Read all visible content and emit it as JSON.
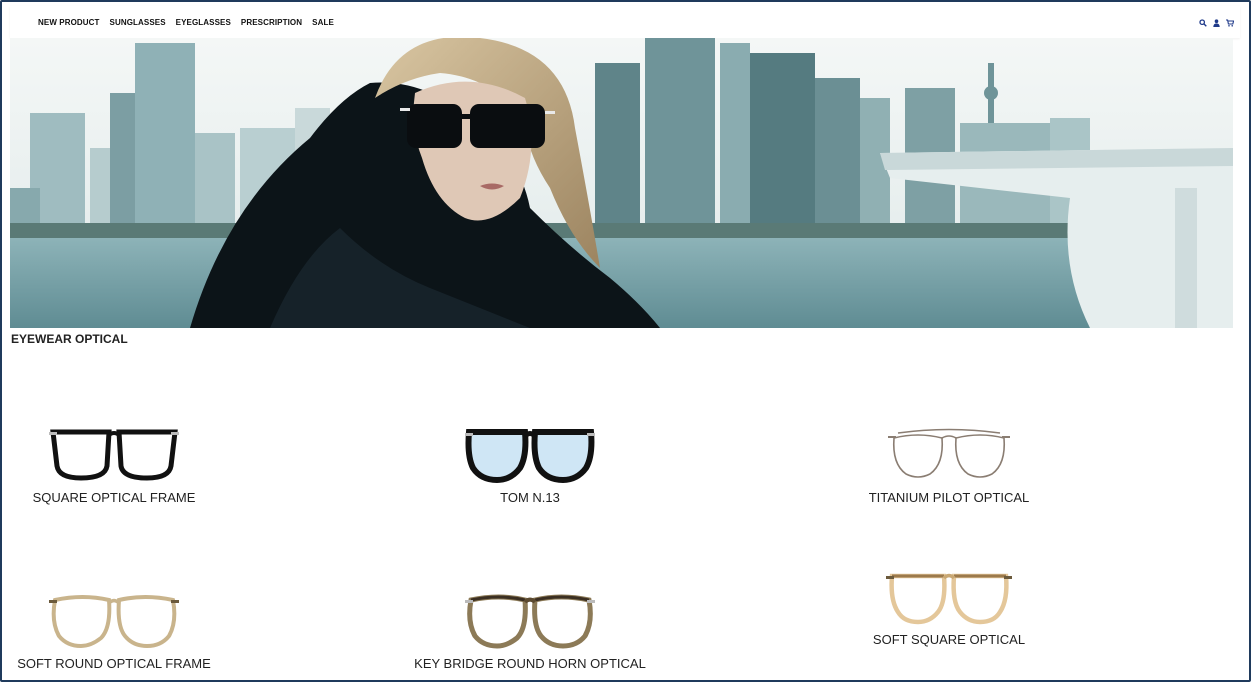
{
  "nav": {
    "items": [
      "NEW PRODUCT",
      "SUNGLASSES",
      "EYEGLASSES",
      "PRESCRIPTION",
      "SALE"
    ],
    "icons": [
      "search-icon",
      "user-icon",
      "cart-icon"
    ],
    "accent": "#1f3a8a"
  },
  "hero": {
    "image": "woman-in-fur-coat-sunglasses-city-skyline",
    "colors": {
      "sky": "#eef3f3",
      "water": "#7fa6ad",
      "buildings": "#4f7478"
    }
  },
  "section": {
    "title": "EYEWEAR OPTICAL"
  },
  "products": [
    {
      "name": "SQUARE OPTICAL FRAME",
      "icon": "square-black-frame-icon"
    },
    {
      "name": "TOM N.13",
      "icon": "round-black-blue-lens-frame-icon"
    },
    {
      "name": "TITANIUM PILOT OPTICAL",
      "icon": "titanium-pilot-frame-icon"
    },
    {
      "name": "SOFT ROUND OPTICAL FRAME",
      "icon": "soft-round-champagne-frame-icon"
    },
    {
      "name": "KEY BRIDGE ROUND HORN OPTICAL",
      "icon": "round-horn-frame-icon"
    },
    {
      "name": "SOFT SQUARE OPTICAL",
      "icon": "soft-square-horn-frame-icon"
    }
  ]
}
